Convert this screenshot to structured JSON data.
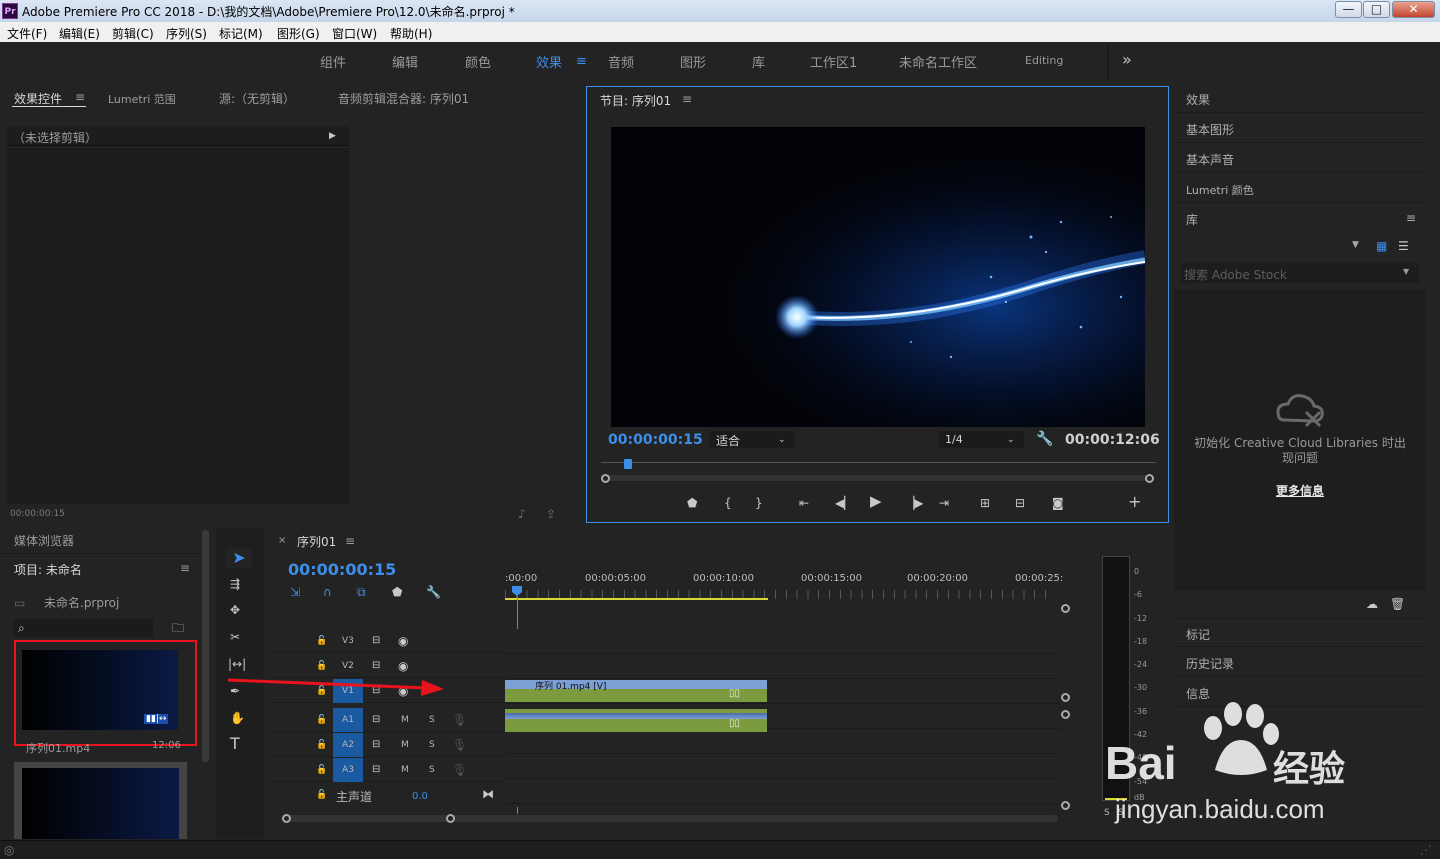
{
  "window": {
    "icon": "Pr",
    "title": "Adobe Premiere Pro CC 2018 - D:\\我的文档\\Adobe\\Premiere Pro\\12.0\\未命名.prproj *",
    "minimize": "—",
    "maximize": "□",
    "close": "✕"
  },
  "menu": [
    "文件(F)",
    "编辑(E)",
    "剪辑(C)",
    "序列(S)",
    "标记(M)",
    "图形(G)",
    "窗口(W)",
    "帮助(H)"
  ],
  "workspaces": {
    "items": [
      "组件",
      "编辑",
      "颜色",
      "效果",
      "音频",
      "图形",
      "库",
      "工作区1",
      "未命名工作区",
      "Editing"
    ],
    "active": "效果",
    "more": "»"
  },
  "source_panel": {
    "tabs": [
      "效果控件",
      "Lumetri 范围",
      "源:（无剪辑）",
      "音频剪辑混合器: 序列01"
    ],
    "no_clip": "（未选择剪辑）",
    "timecode": "00:00:00:15"
  },
  "program": {
    "title": "节目: 序列01",
    "timecode": "00:00:00:15",
    "fit": "适合",
    "resolution": "1/4",
    "duration": "00:00:12:06"
  },
  "right_panel": {
    "items": [
      "效果",
      "基本图形",
      "基本声音",
      "Lumetri 颜色",
      "库"
    ],
    "search_placeholder": "搜索 Adobe Stock",
    "cc_message": "初始化 Creative Cloud Libraries 时出现问题",
    "more_info": "更多信息",
    "bottom_items": [
      "标记",
      "历史记录",
      "信息"
    ]
  },
  "project": {
    "tabs": [
      "媒体浏览器",
      "项目: 未命名"
    ],
    "file": "未命名.prproj",
    "clip_name": "序列01.mp4",
    "clip_duration": "12:06"
  },
  "timeline": {
    "tab": "序列01",
    "timecode": "00:00:00:15",
    "ruler": [
      ":00:00",
      "00:00:05:00",
      "00:00:10:00",
      "00:00:15:00",
      "00:00:20:00",
      "00:00:25:"
    ],
    "video_tracks": [
      "V3",
      "V2",
      "V1"
    ],
    "audio_tracks": [
      "A1",
      "A2",
      "A3"
    ],
    "master": "主声道",
    "master_value": "0.0",
    "clip_label": "序列 01.mp4 [V]",
    "mute": "M",
    "solo": "S"
  },
  "meter": {
    "scale": [
      "0",
      "-6",
      "-12",
      "-18",
      "-24",
      "-30",
      "-36",
      "-42",
      "-48",
      "-54",
      "dB"
    ],
    "solo_labels": [
      "S",
      "S"
    ]
  },
  "watermark": {
    "brand": "Bai",
    "brand2": "经验",
    "url": "jingyan.baidu.com"
  },
  "colors": {
    "accent": "#3d8ee9",
    "clip_video": "#7aa0d4",
    "clip_audio": "#7c9a3e",
    "highlight": "#e8141e"
  }
}
